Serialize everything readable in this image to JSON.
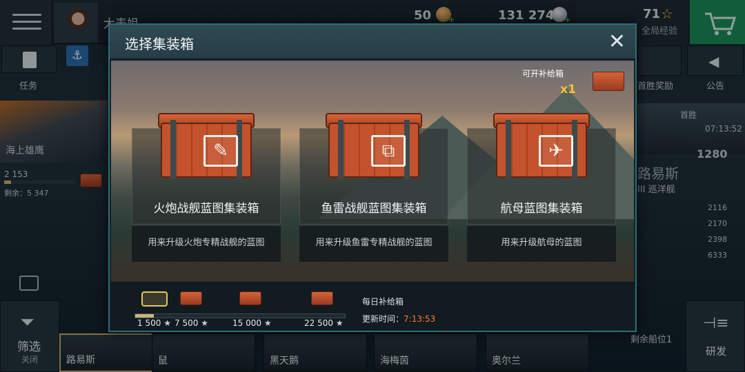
{
  "topbar": {
    "user_name": "大表姐",
    "gold": "50",
    "silver": "131 274",
    "xp": "71",
    "xp_label": "全局经验"
  },
  "left": {
    "tasks_label": "任务",
    "ship_name": "海上雄鹰",
    "stars": "2 153",
    "remaining": "剩余：5 347",
    "filter_label": "筛选",
    "filter_state": "关闭"
  },
  "right": {
    "first_reward": "首胜奖励",
    "announcement": "公告",
    "dock": "首胜",
    "timer": "07:13:52",
    "stars": "1280",
    "ship_name": "路易斯",
    "ship_class": "III 巡洋舰",
    "stats": [
      "2116",
      "2170",
      "2398",
      "6333"
    ],
    "slots_left": "剩余船位1",
    "research": "研发"
  },
  "bottom_ships": [
    "路易斯",
    "鼠",
    "黑天鹅",
    "海梅茵",
    "奥尔兰"
  ],
  "modal": {
    "title": "选择集装箱",
    "close": "✕",
    "supply_label": "可开补给箱",
    "supply_count": "x1",
    "cards": [
      {
        "name": "火炮战舰蓝图集装箱",
        "desc": "用来升级火炮专精战舰的蓝图",
        "icon": "shell-icon",
        "glyph": "✎"
      },
      {
        "name": "鱼雷战舰蓝图集装箱",
        "desc": "用来升级鱼雷专精战舰的蓝图",
        "icon": "torpedo-icon",
        "glyph": "⧉"
      },
      {
        "name": "航母蓝图集装箱",
        "desc": "用来升级航母的蓝图",
        "icon": "plane-icon",
        "glyph": "✈"
      }
    ],
    "milestones": [
      "1 500",
      "7 500",
      "15 000",
      "22 500"
    ],
    "progress_fraction": 0.09,
    "daily_label": "每日补给箱",
    "refresh_label": "更新时间：",
    "refresh_time": "7:13:53"
  }
}
